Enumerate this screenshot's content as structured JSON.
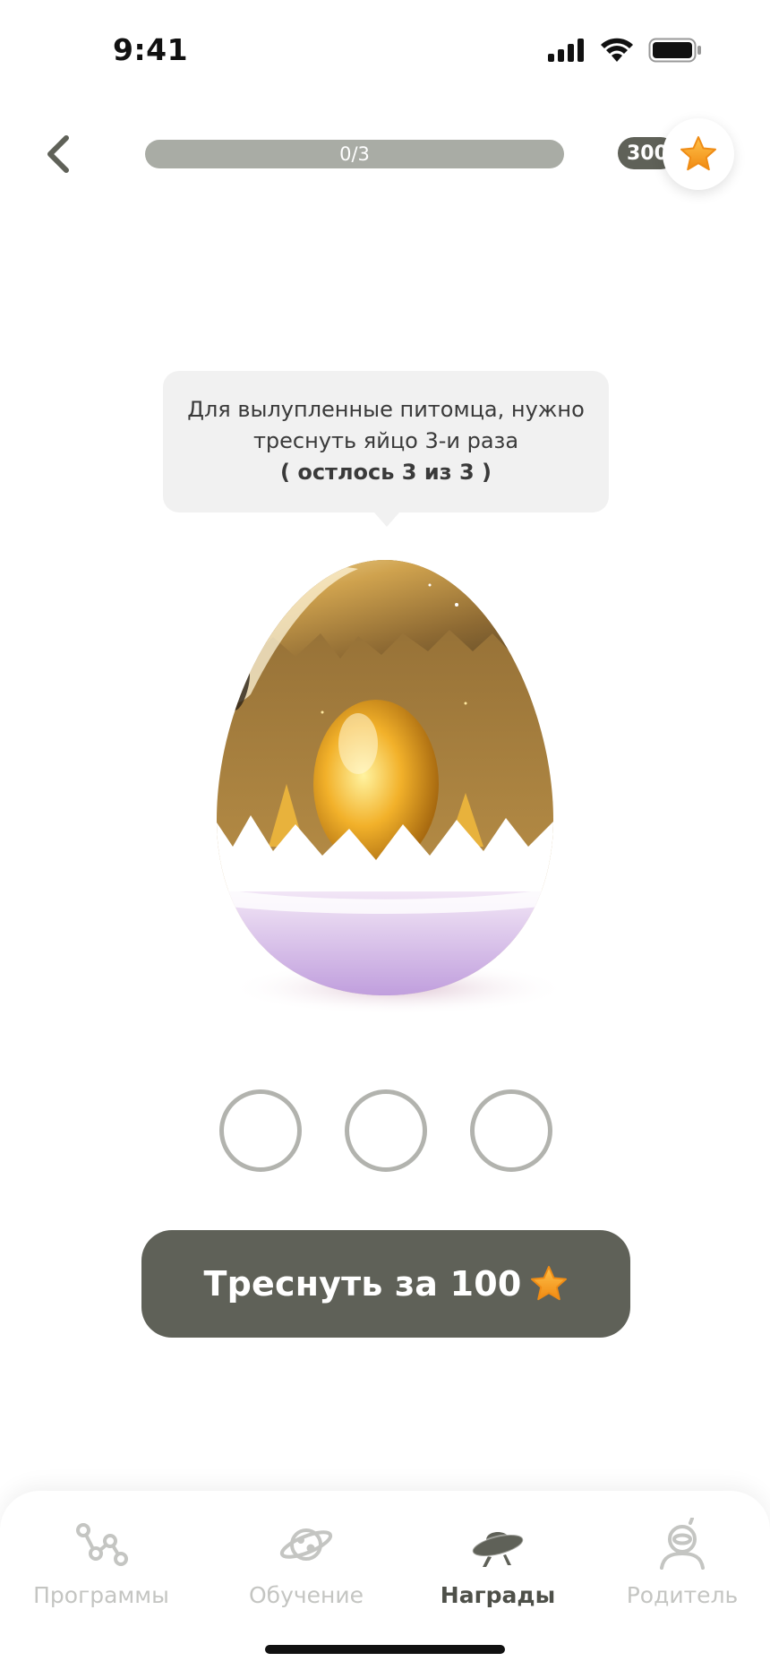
{
  "status_bar": {
    "time": "9:41"
  },
  "header": {
    "progress": {
      "label": "0/3",
      "value": 0,
      "max": 3
    },
    "balance": {
      "count": "300"
    }
  },
  "tooltip": {
    "line1": "Для вылупленные питомца, нужно",
    "line2": "треснуть яйцо 3-и раза",
    "line3": "( остлось 3 из 3 )"
  },
  "attempts": {
    "total": 3,
    "used": 0
  },
  "crack_button": {
    "label": "Треснуть за 100"
  },
  "tabs": [
    {
      "label": "Программы",
      "icon": "programs-icon",
      "active": false
    },
    {
      "label": "Обучение",
      "icon": "planet-icon",
      "active": false
    },
    {
      "label": "Награды",
      "icon": "ufo-icon",
      "active": true
    },
    {
      "label": "Родитель",
      "icon": "astronaut-icon",
      "active": false
    }
  ],
  "colors": {
    "primary": "#5f6158",
    "progress_track": "#a9aca5",
    "star": "#f6a623",
    "inactive_tab": "#c4c5c2"
  }
}
